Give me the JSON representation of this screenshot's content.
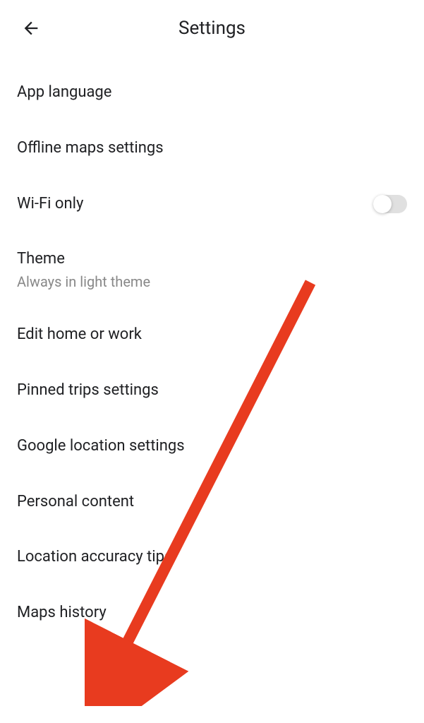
{
  "header": {
    "title": "Settings"
  },
  "items": [
    {
      "label": "App language"
    },
    {
      "label": "Offline maps settings"
    },
    {
      "label": "Wi-Fi only",
      "toggle": false
    },
    {
      "label": "Theme",
      "subtitle": "Always in light theme"
    },
    {
      "label": "Edit home or work"
    },
    {
      "label": "Pinned trips settings"
    },
    {
      "label": "Google location settings"
    },
    {
      "label": "Personal content"
    },
    {
      "label": "Location accuracy tips"
    },
    {
      "label": "Maps history"
    }
  ],
  "annotation": {
    "arrow_color": "#e83b1f"
  }
}
